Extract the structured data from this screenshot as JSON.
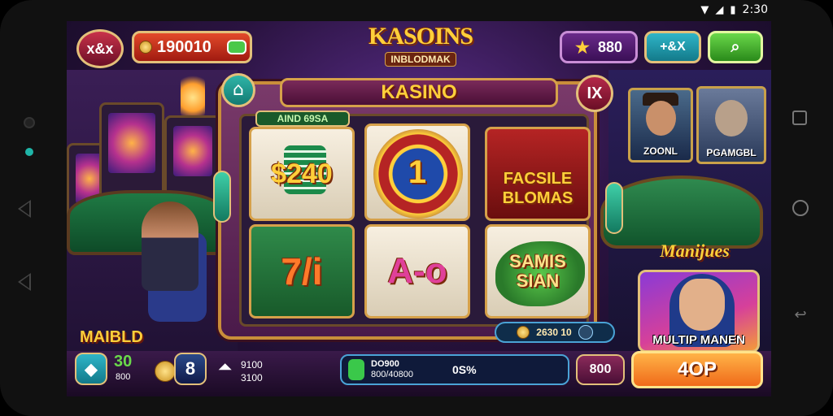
{
  "status_bar": {
    "time": "2:30"
  },
  "hud": {
    "left_badge": "x&x",
    "balance": "190010",
    "gems": "880",
    "icon_btn_label": "+&X"
  },
  "logo": {
    "line1": "KASOINS",
    "line2": "INBLODMAK"
  },
  "panel": {
    "title": "KASINO",
    "close_label": "IX",
    "bonus_tag": "AIND 69SA",
    "cells": [
      {
        "text": "$240"
      },
      {
        "text": "1"
      },
      {
        "text": "FACSILE BLOMAS"
      },
      {
        "text": "7/i"
      },
      {
        "text": "A-o"
      },
      {
        "text": "SAMIS SIAN"
      }
    ],
    "footer_value": "2630 10"
  },
  "right_side": {
    "portrait1_label": "ZOONL",
    "portrait2_label": "PGAMGBL",
    "promo_title": "Manijues",
    "promo_label": "MULTIP MANEN"
  },
  "bottom": {
    "player_name": "MAIBLD",
    "level": "30",
    "level_sub": "800",
    "count": "8",
    "stat1": "9100",
    "stat2": "3100",
    "mid_value": "DO900",
    "mid_sub": "800/40800",
    "mid_right": "0S%",
    "right_value": "800",
    "cta": "4OP"
  },
  "colors": {
    "gold": "#ffcf3a",
    "purple_bg": "#2a1340",
    "green_button": "#5ac84a",
    "teal": "#2fb5a8"
  }
}
